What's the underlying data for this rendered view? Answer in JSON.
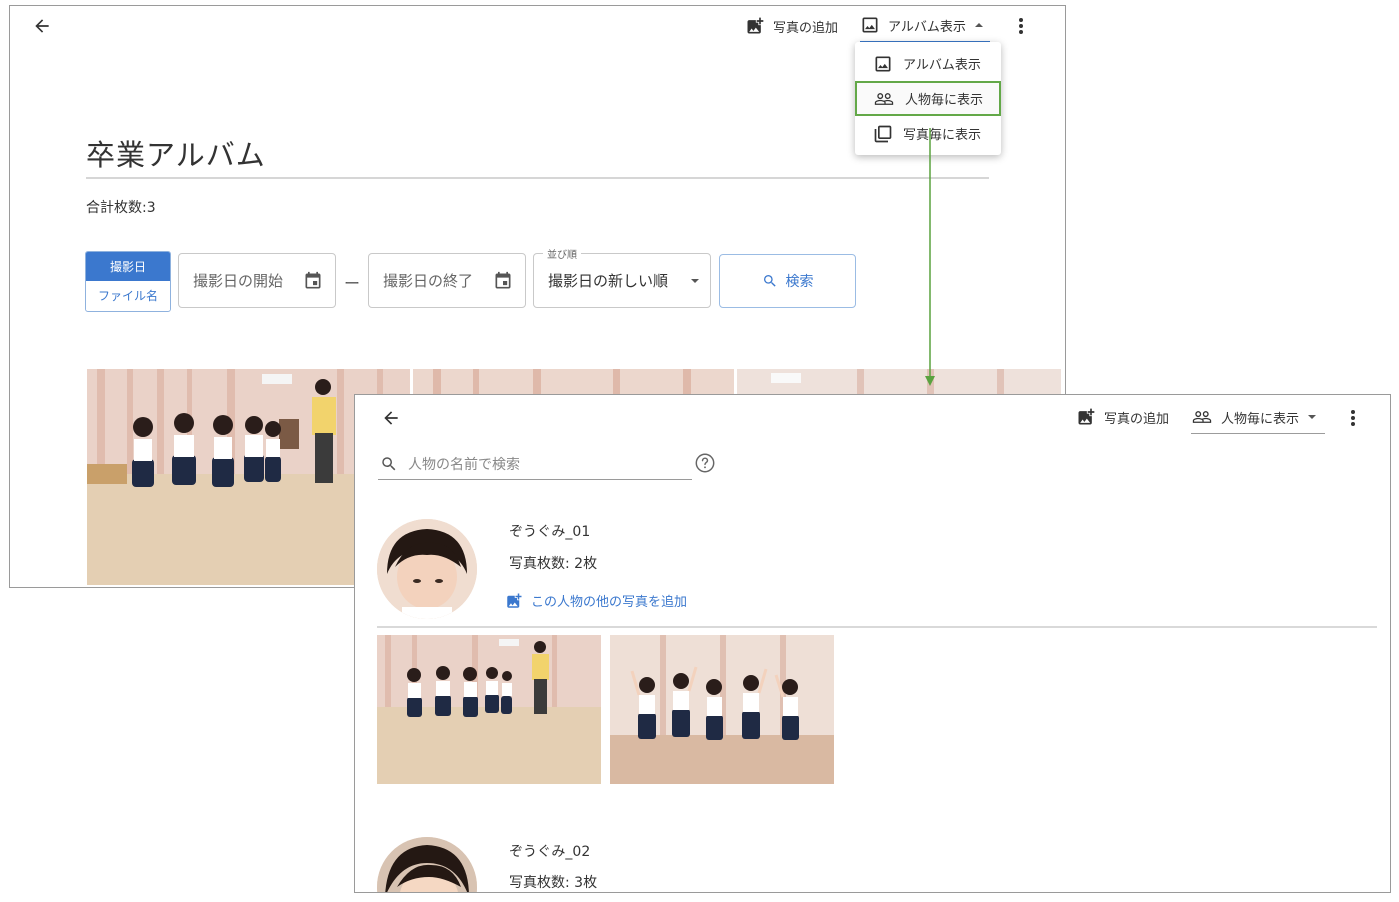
{
  "album_window": {
    "toolbar": {
      "add_photo_label": "写真の追加",
      "view_mode_label": "アルバム表示"
    },
    "menu": {
      "items": [
        {
          "label": "アルバム表示",
          "icon": "image-icon"
        },
        {
          "label": "人物毎に表示",
          "icon": "people-icon",
          "selected": true
        },
        {
          "label": "写真毎に表示",
          "icon": "photo-library-icon"
        }
      ]
    },
    "title": "卒業アルバム",
    "total_count": "合計枚数:3",
    "filter": {
      "sort_key_options": [
        "撮影日",
        "ファイル名"
      ],
      "sort_key_selected": "撮影日",
      "date_start_placeholder": "撮影日の開始",
      "date_range_separator": "ー",
      "date_end_placeholder": "撮影日の終了",
      "sort_order_label": "並び順",
      "sort_order_value": "撮影日の新しい順",
      "search_label": "検索"
    }
  },
  "people_window": {
    "toolbar": {
      "add_photo_label": "写真の追加",
      "view_mode_label": "人物毎に表示"
    },
    "search": {
      "placeholder": "人物の名前で検索"
    },
    "people": [
      {
        "name": "ぞうぐみ_01",
        "photo_count": "写真枚数: 2枚",
        "add_link": "この人物の他の写真を追加"
      },
      {
        "name": "ぞうぐみ_02",
        "photo_count": "写真枚数: 3枚"
      }
    ]
  },
  "colors": {
    "accent": "#3b78ce",
    "highlight": "#63a848"
  }
}
